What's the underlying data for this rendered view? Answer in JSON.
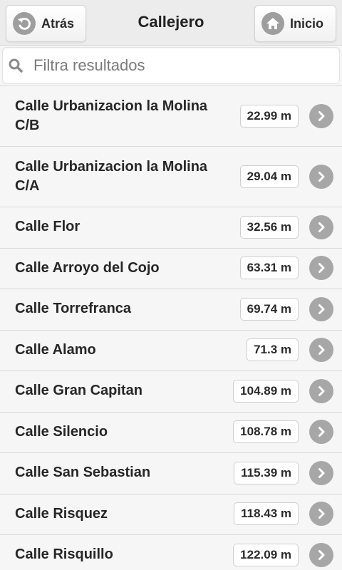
{
  "header": {
    "back_label": "Atrás",
    "title": "Callejero",
    "home_label": "Inicio"
  },
  "search": {
    "placeholder": "Filtra resultados"
  },
  "streets": [
    {
      "name": "Calle Urbanizacion la Molina C/B",
      "distance": "22.99 m"
    },
    {
      "name": "Calle Urbanizacion la Molina C/A",
      "distance": "29.04 m"
    },
    {
      "name": "Calle Flor",
      "distance": "32.56 m"
    },
    {
      "name": "Calle Arroyo del Cojo",
      "distance": "63.31 m"
    },
    {
      "name": "Calle Torrefranca",
      "distance": "69.74 m"
    },
    {
      "name": "Calle Alamo",
      "distance": "71.3 m"
    },
    {
      "name": "Calle Gran Capitan",
      "distance": "104.89 m"
    },
    {
      "name": "Calle Silencio",
      "distance": "108.78 m"
    },
    {
      "name": "Calle San Sebastian",
      "distance": "115.39 m"
    },
    {
      "name": "Calle Risquez",
      "distance": "118.43 m"
    },
    {
      "name": "Calle Risquillo",
      "distance": "122.09 m"
    }
  ]
}
